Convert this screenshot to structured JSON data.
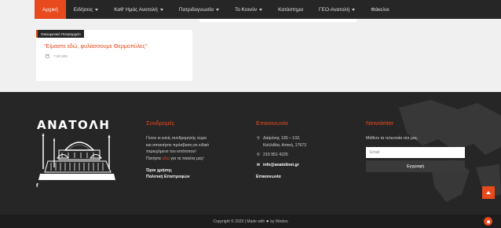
{
  "nav": {
    "items": [
      {
        "label": "Αρχική",
        "active": true,
        "dropdown": false
      },
      {
        "label": "Ειδήσεις",
        "active": false,
        "dropdown": true
      },
      {
        "label": "Καθ' Ημάς Ανατολή",
        "active": false,
        "dropdown": true
      },
      {
        "label": "Πατριδογνωσία",
        "active": false,
        "dropdown": true
      },
      {
        "label": "Το Κοινόν",
        "active": false,
        "dropdown": true
      },
      {
        "label": "Κατάστημα",
        "active": false,
        "dropdown": false
      },
      {
        "label": "ΓΕΟ-Ανατολή",
        "active": false,
        "dropdown": true
      },
      {
        "label": "Φάκελοι",
        "active": false,
        "dropdown": false
      }
    ]
  },
  "card": {
    "category": "Οικουμενικό Πατριαρχείο",
    "title": "\"Είμαστε εδώ, φυλάσσουμε Θερμοπύλες\"",
    "time": "7:30 ΜΜ",
    "calendar_icon": "calendar-icon"
  },
  "footer": {
    "logo": "ΑΝΑΤΟΛΗ",
    "social_icon": "facebook-icon",
    "subscriptions": {
      "title": "Συνδρομές",
      "line1": "Γίνετε κι εσείς συνδρομητής τώρα",
      "line2": "και αποκτήστε πρόσβαση σε ειδικό",
      "line3": "περιεχόμενο του ιστότοπου!",
      "line4_pre": "Πατήστε ",
      "line4_link": "εδώ",
      "line4_post": " για τα πακέτα μας!",
      "terms": "Όροι χρήσης",
      "returns": "Πολιτική Επιστροφών"
    },
    "contact": {
      "title": "Επικοινωνία",
      "address1": "Δαίρόνης 130 – 132,",
      "address2": "Καλλιθέα, Αττική, 17673",
      "phone": "210 951 4225",
      "email": "info@anatolinet.gr",
      "link": "Επικοινωνία"
    },
    "newsletter": {
      "title": "Newsletter",
      "subtitle": "Μάθετε τα τελευταία νέα μας.",
      "placeholder": "Email",
      "button": "Εγγραφή"
    }
  },
  "copyright": {
    "prefix": "Copyright © 2020 | Made with",
    "by": "by",
    "brand": "Wedoo"
  },
  "colors": {
    "accent": "#e8491d",
    "nav_bg": "#262626",
    "footer_bg": "#262626",
    "copyright_bg": "#1d1d1d"
  }
}
